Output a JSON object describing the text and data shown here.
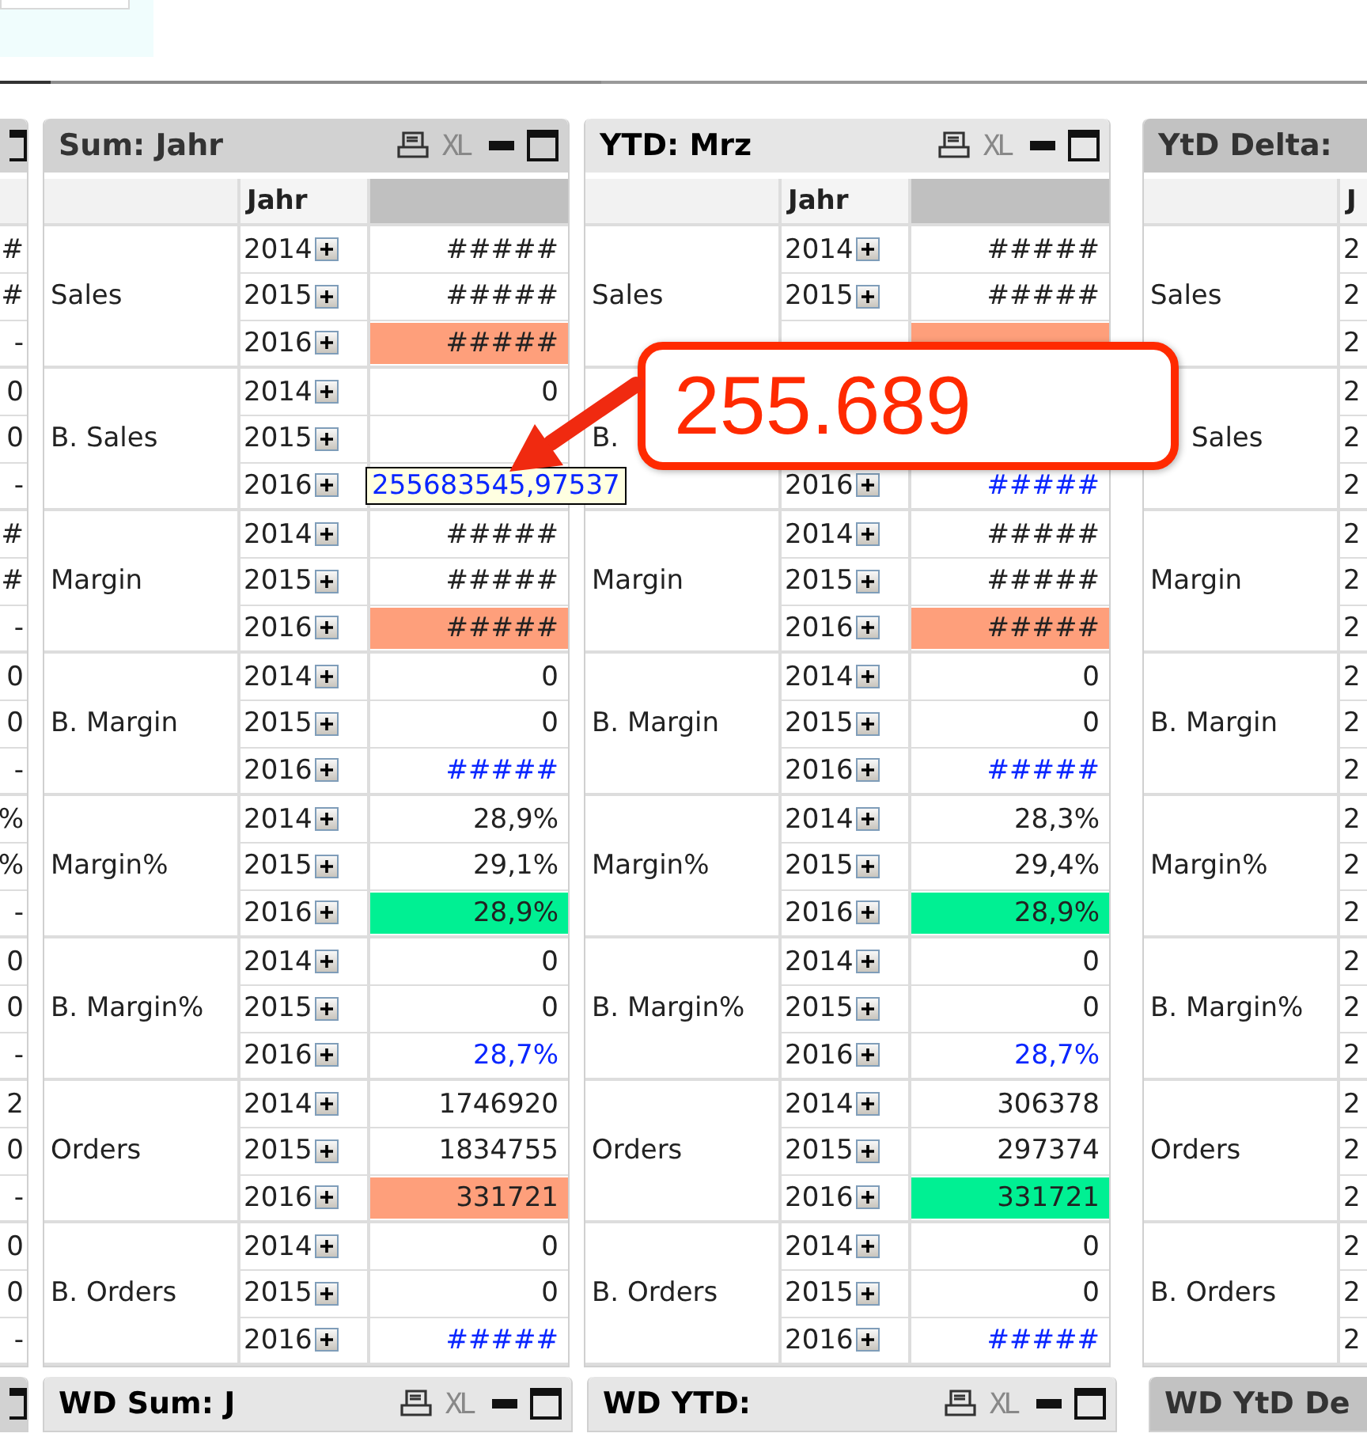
{
  "callout": {
    "text": "255.689"
  },
  "panels": [
    {
      "kind": "stub",
      "active": false,
      "values": [
        "#",
        "#",
        "-",
        "0",
        "0",
        "-",
        "#",
        "#",
        "-",
        "0",
        "0",
        "-",
        "%",
        "%",
        "-",
        "0",
        "0",
        "-",
        "2",
        "0",
        "-",
        "0",
        "0",
        "-"
      ]
    },
    {
      "kind": "full",
      "title": "Sum: Jahr",
      "active": false,
      "xl": "XL",
      "column_header": "Jahr",
      "groups": [
        {
          "label": "Sales",
          "rows": [
            {
              "year": "2014",
              "value": "#####",
              "blue": false
            },
            {
              "year": "2015",
              "value": "#####",
              "blue": false
            },
            {
              "year": "2016",
              "value": "#####",
              "blue": false,
              "color": "#fe9f7b"
            }
          ]
        },
        {
          "label": "B. Sales",
          "rows": [
            {
              "year": "2014",
              "value": "0",
              "blue": false
            },
            {
              "year": "2015"
            },
            {
              "year": "2016",
              "tooltip": "255683545,97537"
            }
          ]
        },
        {
          "label": "Margin",
          "rows": [
            {
              "year": "2014",
              "value": "#####",
              "blue": false
            },
            {
              "year": "2015",
              "value": "#####",
              "blue": false
            },
            {
              "year": "2016",
              "value": "#####",
              "blue": false,
              "color": "#fe9f7b"
            }
          ]
        },
        {
          "label": "B. Margin",
          "rows": [
            {
              "year": "2014",
              "value": "0",
              "blue": false
            },
            {
              "year": "2015",
              "value": "0",
              "blue": false
            },
            {
              "year": "2016",
              "value": "#####",
              "blue": true
            }
          ]
        },
        {
          "label": "Margin%",
          "rows": [
            {
              "year": "2014",
              "value": "28,9%",
              "blue": false
            },
            {
              "year": "2015",
              "value": "29,1%",
              "blue": false
            },
            {
              "year": "2016",
              "value": "28,9%",
              "blue": false,
              "color": "#00f093"
            }
          ]
        },
        {
          "label": "B. Margin%",
          "rows": [
            {
              "year": "2014",
              "value": "0",
              "blue": false
            },
            {
              "year": "2015",
              "value": "0",
              "blue": false
            },
            {
              "year": "2016",
              "value": "28,7%",
              "blue": true
            }
          ]
        },
        {
          "label": "Orders",
          "rows": [
            {
              "year": "2014",
              "value": "1746920",
              "blue": false
            },
            {
              "year": "2015",
              "value": "1834755",
              "blue": false
            },
            {
              "year": "2016",
              "value": "331721",
              "blue": false,
              "color": "#fe9f7b"
            }
          ]
        },
        {
          "label": "B. Orders",
          "rows": [
            {
              "year": "2014",
              "value": "0",
              "blue": false
            },
            {
              "year": "2015",
              "value": "0",
              "blue": false
            },
            {
              "year": "2016",
              "value": "#####",
              "blue": true
            }
          ]
        }
      ]
    },
    {
      "kind": "full",
      "title": "YTD: Mrz",
      "active": true,
      "xl": "XL",
      "column_header": "Jahr",
      "groups": [
        {
          "label": "Sales",
          "rows": [
            {
              "year": "2014",
              "value": "#####",
              "blue": false
            },
            {
              "year": "2015",
              "value": "#####",
              "blue": false
            },
            {
              "color": "#fe9f7b"
            }
          ]
        },
        {
          "label": "B.",
          "rows": [
            {},
            {},
            {
              "year": "2016",
              "value": "#####",
              "blue": true
            }
          ]
        },
        {
          "label": "Margin",
          "rows": [
            {
              "year": "2014",
              "value": "#####",
              "blue": false
            },
            {
              "year": "2015",
              "value": "#####",
              "blue": false
            },
            {
              "year": "2016",
              "value": "#####",
              "blue": false,
              "color": "#fe9f7b"
            }
          ]
        },
        {
          "label": "B. Margin",
          "rows": [
            {
              "year": "2014",
              "value": "0",
              "blue": false
            },
            {
              "year": "2015",
              "value": "0",
              "blue": false
            },
            {
              "year": "2016",
              "value": "#####",
              "blue": true
            }
          ]
        },
        {
          "label": "Margin%",
          "rows": [
            {
              "year": "2014",
              "value": "28,3%",
              "blue": false
            },
            {
              "year": "2015",
              "value": "29,4%",
              "blue": false
            },
            {
              "year": "2016",
              "value": "28,9%",
              "blue": false,
              "color": "#00f093"
            }
          ]
        },
        {
          "label": "B. Margin%",
          "rows": [
            {
              "year": "2014",
              "value": "0",
              "blue": false
            },
            {
              "year": "2015",
              "value": "0",
              "blue": false
            },
            {
              "year": "2016",
              "value": "28,7%",
              "blue": true
            }
          ]
        },
        {
          "label": "Orders",
          "rows": [
            {
              "year": "2014",
              "value": "306378",
              "blue": false
            },
            {
              "year": "2015",
              "value": "297374",
              "blue": false
            },
            {
              "year": "2016",
              "value": "331721",
              "blue": false,
              "color": "#00f093"
            }
          ]
        },
        {
          "label": "B. Orders",
          "rows": [
            {
              "year": "2014",
              "value": "0",
              "blue": false
            },
            {
              "year": "2015",
              "value": "0",
              "blue": false
            },
            {
              "year": "2016",
              "value": "#####",
              "blue": true
            }
          ]
        }
      ]
    },
    {
      "kind": "cut",
      "title": "YtD Delta:",
      "active": false,
      "column_header": "J",
      "groups": [
        {
          "label": "Sales",
          "rows": [
            {
              "year": "2"
            },
            {
              "year": "2"
            },
            {
              "year": "2"
            }
          ]
        },
        {
          "label": "Sales",
          "partly_hidden": true,
          "rows": [
            {
              "year": "2"
            },
            {
              "year": "2"
            },
            {
              "year": "2"
            }
          ]
        },
        {
          "label": "Margin",
          "rows": [
            {
              "year": "2"
            },
            {
              "year": "2"
            },
            {
              "year": "2"
            }
          ]
        },
        {
          "label": "B. Margin",
          "rows": [
            {
              "year": "2"
            },
            {
              "year": "2"
            },
            {
              "year": "2"
            }
          ]
        },
        {
          "label": "Margin%",
          "rows": [
            {
              "year": "2"
            },
            {
              "year": "2"
            },
            {
              "year": "2"
            }
          ]
        },
        {
          "label": "B. Margin%",
          "rows": [
            {
              "year": "2"
            },
            {
              "year": "2"
            },
            {
              "year": "2"
            }
          ]
        },
        {
          "label": "Orders",
          "rows": [
            {
              "year": "2"
            },
            {
              "year": "2"
            },
            {
              "year": "2"
            }
          ]
        },
        {
          "label": "B. Orders",
          "rows": [
            {
              "year": "2"
            },
            {
              "year": "2"
            },
            {
              "year": "2"
            }
          ]
        }
      ]
    }
  ],
  "lower_panels": [
    {
      "kind": "stub",
      "active": false
    },
    {
      "kind": "full",
      "title": "WD Sum: J",
      "active": true,
      "xl": "XL"
    },
    {
      "kind": "full",
      "title": "WD YTD:",
      "active": true,
      "xl": "XL"
    },
    {
      "kind": "cut",
      "title": "WD YtD De",
      "active": false
    }
  ]
}
